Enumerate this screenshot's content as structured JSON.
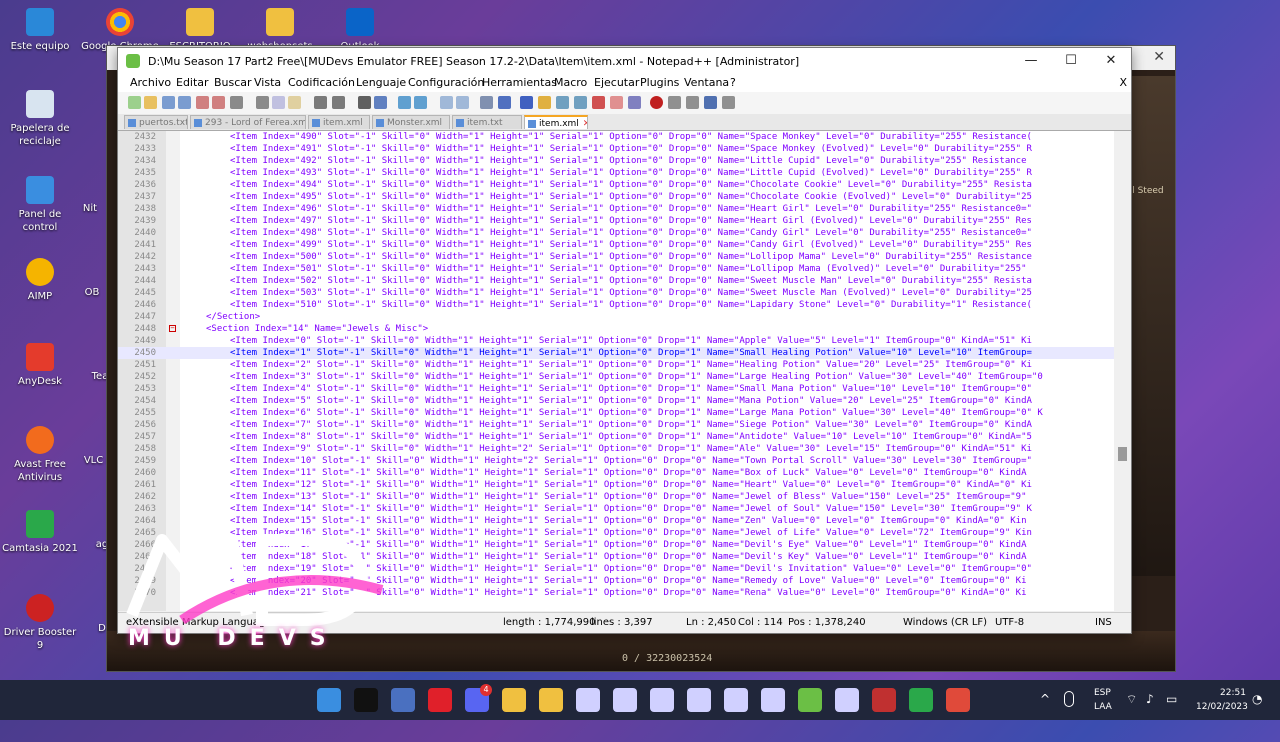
{
  "desktop": {
    "icons": [
      {
        "label": "Este equipo",
        "icon": "computer-icon"
      },
      {
        "label": "Google Chrome",
        "icon": "chrome-icon"
      },
      {
        "label": "ESCRITORIO MU",
        "icon": "folder-icon"
      },
      {
        "label": "webshopsets",
        "icon": "folder-icon"
      },
      {
        "label": "Outlook",
        "icon": "outlook-icon"
      },
      {
        "label": "Papelera de reciclaje",
        "icon": "recycle-bin-icon"
      },
      {
        "label": "Panel de control",
        "icon": "control-panel-icon"
      },
      {
        "label": "Nit",
        "icon": "app-icon"
      },
      {
        "label": "AIMP",
        "icon": "aimp-icon"
      },
      {
        "label": "OB",
        "icon": "app-icon"
      },
      {
        "label": "AnyDesk",
        "icon": "anydesk-icon"
      },
      {
        "label": "Tea",
        "icon": "app-icon"
      },
      {
        "label": "Avast Free Antivirus",
        "icon": "avast-icon"
      },
      {
        "label": "VLC m",
        "icon": "vlc-icon"
      },
      {
        "label": "Camtasia 2021",
        "icon": "camtasia-icon"
      },
      {
        "label": "ag",
        "icon": "app-icon"
      },
      {
        "label": "Driver Booster 9",
        "icon": "driver-booster-icon"
      },
      {
        "label": "D",
        "icon": "app-icon"
      }
    ]
  },
  "game_window": {
    "side_text": "nal Steed",
    "footer_text": "0 / 32230023524"
  },
  "npp": {
    "title": "D:\\Mu Season 17 Part2 Free\\[MUDevs Emulator FREE] Season 17.2-2\\Data\\Item\\item.xml - Notepad++ [Administrator]",
    "window_buttons": {
      "minimize": "—",
      "maximize": "☐",
      "close": "✕"
    },
    "menu": [
      "Archivo",
      "Editar",
      "Buscar",
      "Vista",
      "Codificación",
      "Lenguaje",
      "Configuración",
      "Herramientas",
      "Macro",
      "Ejecutar",
      "Plugins",
      "Ventana",
      "?"
    ],
    "menu_close": "X",
    "tabs": [
      {
        "label": "puertos.txt",
        "active": false
      },
      {
        "label": "293 - Lord of Ferea.xml",
        "active": false
      },
      {
        "label": "item.xml",
        "active": false
      },
      {
        "label": "Monster.xml",
        "active": false
      },
      {
        "label": "item.txt",
        "active": false
      },
      {
        "label": "item.xml",
        "active": true,
        "close": "✕"
      }
    ],
    "lines": [
      {
        "n": "2432",
        "text": "<Item Index=\"490\" Slot=\"-1\" Skill=\"0\" Width=\"1\" Height=\"1\" Serial=\"1\" Option=\"0\" Drop=\"0\" Name=\"Space Monkey\" Level=\"0\" Durability=\"255\" Resistance(",
        "kind": "item"
      },
      {
        "n": "2433",
        "text": "<Item Index=\"491\" Slot=\"-1\" Skill=\"0\" Width=\"1\" Height=\"1\" Serial=\"1\" Option=\"0\" Drop=\"0\" Name=\"Space Monkey (Evolved)\" Level=\"0\" Durability=\"255\" R",
        "kind": "item"
      },
      {
        "n": "2434",
        "text": "<Item Index=\"492\" Slot=\"-1\" Skill=\"0\" Width=\"1\" Height=\"1\" Serial=\"1\" Option=\"0\" Drop=\"0\" Name=\"Little Cupid\" Level=\"0\" Durability=\"255\" Resistance",
        "kind": "item"
      },
      {
        "n": "2435",
        "text": "<Item Index=\"493\" Slot=\"-1\" Skill=\"0\" Width=\"1\" Height=\"1\" Serial=\"1\" Option=\"0\" Drop=\"0\" Name=\"Little Cupid (Evolved)\" Level=\"0\" Durability=\"255\" R",
        "kind": "item"
      },
      {
        "n": "2436",
        "text": "<Item Index=\"494\" Slot=\"-1\" Skill=\"0\" Width=\"1\" Height=\"1\" Serial=\"1\" Option=\"0\" Drop=\"0\" Name=\"Chocolate Cookie\" Level=\"0\" Durability=\"255\" Resista",
        "kind": "item"
      },
      {
        "n": "2437",
        "text": "<Item Index=\"495\" Slot=\"-1\" Skill=\"0\" Width=\"1\" Height=\"1\" Serial=\"1\" Option=\"0\" Drop=\"0\" Name=\"Chocolate Cookie (Evolved)\" Level=\"0\" Durability=\"25",
        "kind": "item"
      },
      {
        "n": "2438",
        "text": "<Item Index=\"496\" Slot=\"-1\" Skill=\"0\" Width=\"1\" Height=\"1\" Serial=\"1\" Option=\"0\" Drop=\"0\" Name=\"Heart Girl\" Level=\"0\" Durability=\"255\" Resistance0=\"",
        "kind": "item"
      },
      {
        "n": "2439",
        "text": "<Item Index=\"497\" Slot=\"-1\" Skill=\"0\" Width=\"1\" Height=\"1\" Serial=\"1\" Option=\"0\" Drop=\"0\" Name=\"Heart Girl (Evolved)\" Level=\"0\" Durability=\"255\" Res",
        "kind": "item"
      },
      {
        "n": "2440",
        "text": "<Item Index=\"498\" Slot=\"-1\" Skill=\"0\" Width=\"1\" Height=\"1\" Serial=\"1\" Option=\"0\" Drop=\"0\" Name=\"Candy Girl\" Level=\"0\" Durability=\"255\" Resistance0=\"",
        "kind": "item"
      },
      {
        "n": "2441",
        "text": "<Item Index=\"499\" Slot=\"-1\" Skill=\"0\" Width=\"1\" Height=\"1\" Serial=\"1\" Option=\"0\" Drop=\"0\" Name=\"Candy Girl (Evolved)\" Level=\"0\" Durability=\"255\" Res",
        "kind": "item"
      },
      {
        "n": "2442",
        "text": "<Item Index=\"500\" Slot=\"-1\" Skill=\"0\" Width=\"1\" Height=\"1\" Serial=\"1\" Option=\"0\" Drop=\"0\" Name=\"Lollipop Mama\" Level=\"0\" Durability=\"255\" Resistance",
        "kind": "item"
      },
      {
        "n": "2443",
        "text": "<Item Index=\"501\" Slot=\"-1\" Skill=\"0\" Width=\"1\" Height=\"1\" Serial=\"1\" Option=\"0\" Drop=\"0\" Name=\"Lollipop Mama (Evolved)\" Level=\"0\" Durability=\"255\"",
        "kind": "item"
      },
      {
        "n": "2444",
        "text": "<Item Index=\"502\" Slot=\"-1\" Skill=\"0\" Width=\"1\" Height=\"1\" Serial=\"1\" Option=\"0\" Drop=\"0\" Name=\"Sweet Muscle Man\" Level=\"0\" Durability=\"255\" Resista",
        "kind": "item"
      },
      {
        "n": "2445",
        "text": "<Item Index=\"503\" Slot=\"-1\" Skill=\"0\" Width=\"1\" Height=\"1\" Serial=\"1\" Option=\"0\" Drop=\"0\" Name=\"Sweet Muscle Man (Evolved)\" Level=\"0\" Durability=\"25",
        "kind": "item"
      },
      {
        "n": "2446",
        "text": "<Item Index=\"510\" Slot=\"-1\" Skill=\"0\" Width=\"1\" Height=\"1\" Serial=\"1\" Option=\"0\" Drop=\"0\" Name=\"Lapidary Stone\" Level=\"0\" Durability=\"1\" Resistance(",
        "kind": "item"
      },
      {
        "n": "2447",
        "text": "</Section>",
        "kind": "sec"
      },
      {
        "n": "2448",
        "text": "<Section Index=\"14\" Name=\"Jewels & Misc\">",
        "kind": "sec",
        "fold": true
      },
      {
        "n": "2449",
        "text": "<Item Index=\"0\" Slot=\"-1\" Skill=\"0\" Width=\"1\" Height=\"1\" Serial=\"1\" Option=\"0\" Drop=\"1\" Name=\"Apple\" Value=\"5\" Level=\"1\" ItemGroup=\"0\" KindA=\"51\" Ki",
        "kind": "item"
      },
      {
        "n": "2450",
        "text": "<Item Index=\"1\" Slot=\"-1\" Skill=\"0\" Width=\"1\" Height=\"1\" Serial=\"1\" Option=\"0\" Drop=\"1\" Name=\"Small Healing Potion\" Value=\"10\" Level=\"10\" ItemGroup=",
        "kind": "item",
        "highlight": true
      },
      {
        "n": "2451",
        "text": "<Item Index=\"2\" Slot=\"-1\" Skill=\"0\" Width=\"1\" Height=\"1\" Serial=\"1\" Option=\"0\" Drop=\"1\" Name=\"Healing Potion\" Value=\"20\" Level=\"25\" ItemGroup=\"0\" Ki",
        "kind": "item"
      },
      {
        "n": "2452",
        "text": "<Item Index=\"3\" Slot=\"-1\" Skill=\"0\" Width=\"1\" Height=\"1\" Serial=\"1\" Option=\"0\" Drop=\"1\" Name=\"Large Healing Potion\" Value=\"30\" Level=\"40\" ItemGroup=\"0",
        "kind": "item"
      },
      {
        "n": "2453",
        "text": "<Item Index=\"4\" Slot=\"-1\" Skill=\"0\" Width=\"1\" Height=\"1\" Serial=\"1\" Option=\"0\" Drop=\"1\" Name=\"Small Mana Potion\" Value=\"10\" Level=\"10\" ItemGroup=\"0\"",
        "kind": "item"
      },
      {
        "n": "2454",
        "text": "<Item Index=\"5\" Slot=\"-1\" Skill=\"0\" Width=\"1\" Height=\"1\" Serial=\"1\" Option=\"0\" Drop=\"1\" Name=\"Mana Potion\" Value=\"20\" Level=\"25\" ItemGroup=\"0\" KindA",
        "kind": "item"
      },
      {
        "n": "2455",
        "text": "<Item Index=\"6\" Slot=\"-1\" Skill=\"0\" Width=\"1\" Height=\"1\" Serial=\"1\" Option=\"0\" Drop=\"1\" Name=\"Large Mana Potion\" Value=\"30\" Level=\"40\" ItemGroup=\"0\" K",
        "kind": "item"
      },
      {
        "n": "2456",
        "text": "<Item Index=\"7\" Slot=\"-1\" Skill=\"0\" Width=\"1\" Height=\"1\" Serial=\"1\" Option=\"0\" Drop=\"1\" Name=\"Siege Potion\" Value=\"30\" Level=\"0\" ItemGroup=\"0\" KindA",
        "kind": "item"
      },
      {
        "n": "2457",
        "text": "<Item Index=\"8\" Slot=\"-1\" Skill=\"0\" Width=\"1\" Height=\"1\" Serial=\"1\" Option=\"0\" Drop=\"1\" Name=\"Antidote\" Value=\"10\" Level=\"10\" ItemGroup=\"0\" KindA=\"5",
        "kind": "item"
      },
      {
        "n": "2458",
        "text": "<Item Index=\"9\" Slot=\"-1\" Skill=\"0\" Width=\"1\" Height=\"2\" Serial=\"1\" Option=\"0\" Drop=\"1\" Name=\"Ale\" Value=\"30\" Level=\"15\" ItemGroup=\"0\" KindA=\"51\" Ki",
        "kind": "item"
      },
      {
        "n": "2459",
        "text": "<Item Index=\"10\" Slot=\"-1\" Skill=\"0\" Width=\"1\" Height=\"2\" Serial=\"1\" Option=\"0\" Drop=\"0\" Name=\"Town Portal Scroll\" Value=\"30\" Level=\"30\" ItemGroup=\"",
        "kind": "item"
      },
      {
        "n": "2460",
        "text": "<Item Index=\"11\" Slot=\"-1\" Skill=\"0\" Width=\"1\" Height=\"1\" Serial=\"1\" Option=\"0\" Drop=\"0\" Name=\"Box of Luck\" Value=\"0\" Level=\"0\" ItemGroup=\"0\" KindA",
        "kind": "item"
      },
      {
        "n": "2461",
        "text": "<Item Index=\"12\" Slot=\"-1\" Skill=\"0\" Width=\"1\" Height=\"1\" Serial=\"1\" Option=\"0\" Drop=\"0\" Name=\"Heart\" Value=\"0\" Level=\"0\" ItemGroup=\"0\" KindA=\"0\" Ki",
        "kind": "item"
      },
      {
        "n": "2462",
        "text": "<Item Index=\"13\" Slot=\"-1\" Skill=\"0\" Width=\"1\" Height=\"1\" Serial=\"1\" Option=\"0\" Drop=\"0\" Name=\"Jewel of Bless\" Value=\"150\" Level=\"25\" ItemGroup=\"9\"",
        "kind": "item"
      },
      {
        "n": "2463",
        "text": "<Item Index=\"14\" Slot=\"-1\" Skill=\"0\" Width=\"1\" Height=\"1\" Serial=\"1\" Option=\"0\" Drop=\"0\" Name=\"Jewel of Soul\" Value=\"150\" Level=\"30\" ItemGroup=\"9\" K",
        "kind": "item"
      },
      {
        "n": "2464",
        "text": "<Item Index=\"15\" Slot=\"-1\" Skill=\"0\" Width=\"1\" Height=\"1\" Serial=\"1\" Option=\"0\" Drop=\"0\" Name=\"Zen\" Value=\"0\" Level=\"0\" ItemGroup=\"0\" KindA=\"0\" Kin",
        "kind": "item"
      },
      {
        "n": "2465",
        "text": "<Item Index=\"16\" Slot=\"-1\" Skill=\"0\" Width=\"1\" Height=\"1\" Serial=\"1\" Option=\"0\" Drop=\"0\" Name=\"Jewel of Life\" Value=\"0\" Level=\"72\" ItemGroup=\"9\" Kin",
        "kind": "item"
      },
      {
        "n": "2466",
        "text": "<Item Index=\"17\" Slot=\"-1\" Skill=\"0\" Width=\"1\" Height=\"1\" Serial=\"1\" Option=\"0\" Drop=\"0\" Name=\"Devil's Eye\" Value=\"0\" Level=\"1\" ItemGroup=\"0\" KindA",
        "kind": "item"
      },
      {
        "n": "2467",
        "text": "<Item Index=\"18\" Slot=\"-1\" Skill=\"0\" Width=\"1\" Height=\"1\" Serial=\"1\" Option=\"0\" Drop=\"0\" Name=\"Devil's Key\" Value=\"0\" Level=\"1\" ItemGroup=\"0\" KindA",
        "kind": "item"
      },
      {
        "n": "2468",
        "text": "<Item Index=\"19\" Slot=\"-1\" Skill=\"0\" Width=\"1\" Height=\"1\" Serial=\"1\" Option=\"0\" Drop=\"0\" Name=\"Devil's Invitation\" Value=\"0\" Level=\"0\" ItemGroup=\"0\"",
        "kind": "item"
      },
      {
        "n": "2469",
        "text": "<Item Index=\"20\" Slot=\"-1\" Skill=\"0\" Width=\"1\" Height=\"1\" Serial=\"1\" Option=\"0\" Drop=\"0\" Name=\"Remedy of Love\" Value=\"0\" Level=\"0\" ItemGroup=\"0\" Ki",
        "kind": "item"
      },
      {
        "n": "2470",
        "text": "<Item Index=\"21\" Slot=\"-1\" Skill=\"0\" Width=\"1\" Height=\"1\" Serial=\"1\" Option=\"0\" Drop=\"0\" Name=\"Rena\" Value=\"0\" Level=\"0\" ItemGroup=\"0\" KindA=\"0\" Ki",
        "kind": "item"
      }
    ],
    "status": {
      "language": "eXtensible Markup Language file",
      "length": "length : 1,774,990",
      "lines": "lines : 3,397",
      "ln": "Ln : 2,450",
      "col": "Col : 114",
      "pos": "Pos : 1,378,240",
      "eol": "Windows (CR LF)",
      "encoding": "UTF-8",
      "mode": "INS"
    }
  },
  "logo": {
    "text": "MU DEVS"
  },
  "taskbar": {
    "apps": [
      "windows-start-icon",
      "netflix-icon",
      "file-manager-icon",
      "opera-icon",
      "discord-icon",
      "tools-icon",
      "folder-icon",
      "mu-icon",
      "mu-icon",
      "mu-icon",
      "mu-icon",
      "mu-icon",
      "mu-icon",
      "notepadpp-icon",
      "mu-icon",
      "game-icon",
      "camtasia-icon",
      "camtasia-rec-icon"
    ],
    "discord_badge": "4",
    "lang": "ESP",
    "layout": "LAA",
    "time": "22:51",
    "date": "12/02/2023"
  }
}
